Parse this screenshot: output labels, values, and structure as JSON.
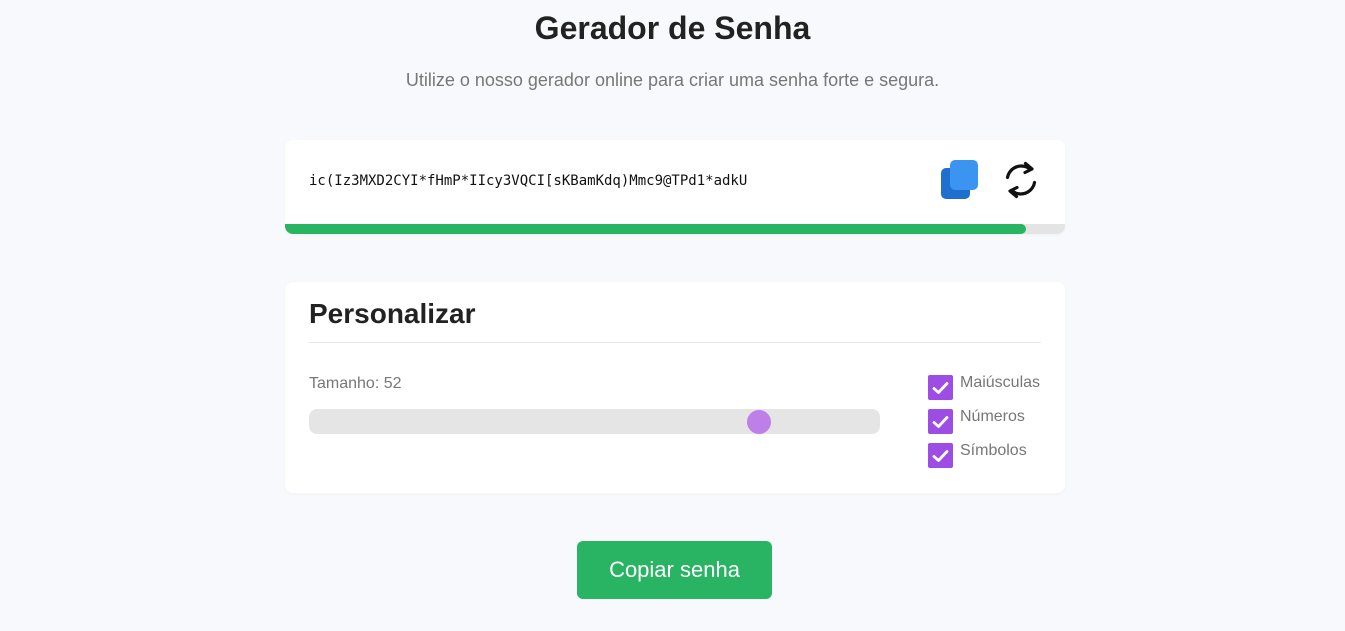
{
  "header": {
    "title": "Gerador de Senha",
    "subtitle": "Utilize o nosso gerador online para criar uma senha forte e segura."
  },
  "password": {
    "value": "ic(Iz3MXD2CYI*fHmP*IIcy3VQCI[sKBamKdq)Mmc9@TPd1*adkU",
    "copy_icon": "copy-icon",
    "refresh_icon": "refresh-icon",
    "strength_fraction": 0.95,
    "strength_color": "#28b463"
  },
  "customize": {
    "title": "Personalizar",
    "length_label": "Tamanho: 52",
    "slider": {
      "value": 52,
      "min": 4,
      "max": 64,
      "color": "#bf7fe8"
    },
    "options": [
      {
        "label": "Maiúsculas",
        "checked": true
      },
      {
        "label": "Números",
        "checked": true
      },
      {
        "label": "Símbolos",
        "checked": true
      }
    ],
    "checkbox_color": "#9d4de3"
  },
  "actions": {
    "copy_label": "Copiar senha",
    "accent_color": "#28b463"
  }
}
